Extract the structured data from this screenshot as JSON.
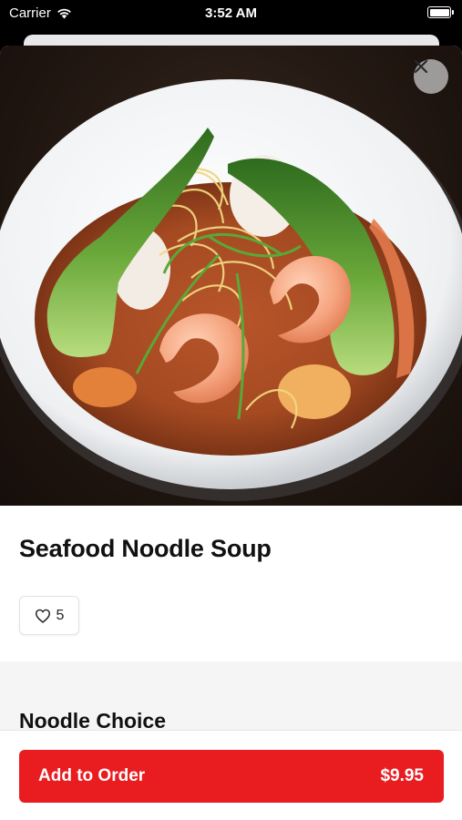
{
  "status_bar": {
    "carrier": "Carrier",
    "time": "3:52 AM",
    "wifi_icon": "wifi-icon",
    "battery_icon": "battery-icon"
  },
  "item": {
    "image_alt": "seafood-noodle-soup-photo",
    "title": "Seafood Noodle Soup",
    "like_icon": "heart-outline-icon",
    "like_count": "5"
  },
  "close_icon": "close-icon",
  "options": {
    "section_title": "Noodle Choice"
  },
  "order_button": {
    "label": "Add to Order",
    "price": "$9.95"
  },
  "colors": {
    "accent": "#e91c20",
    "section_bg": "#f5f5f5"
  }
}
